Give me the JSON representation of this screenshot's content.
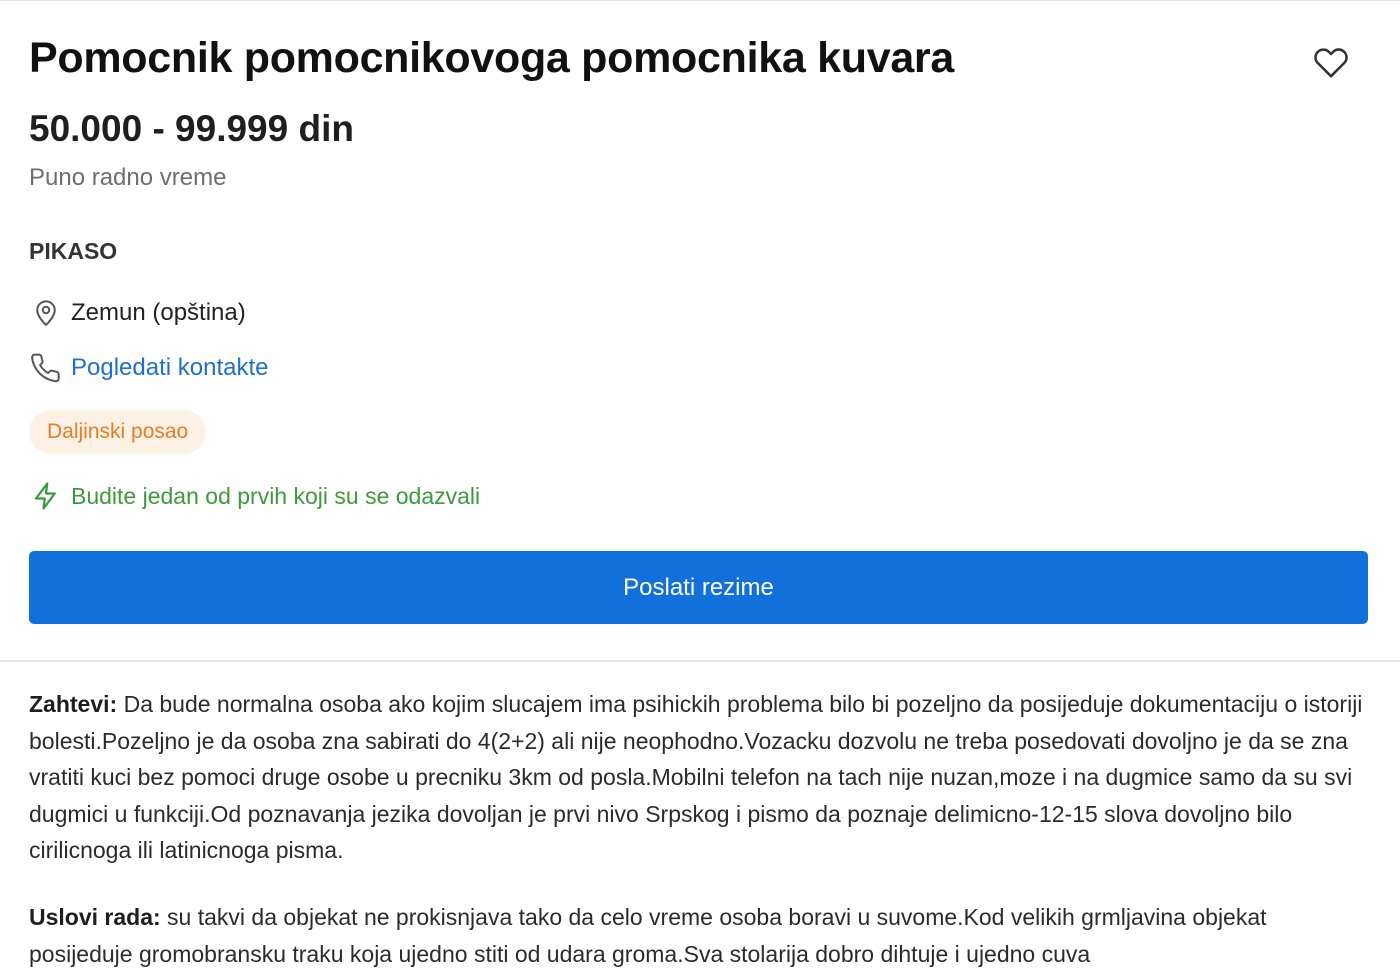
{
  "job": {
    "title": "Pomocnik pomocnikovoga pomocnika kuvara",
    "salary": "50.000 - 99.999 din",
    "work_type": "Puno radno vreme",
    "company": "PIKASO",
    "location": "Zemun (opština)",
    "contact_link": "Pogledati kontakte",
    "badge": "Daljinski posao",
    "early_applicant": "Budite jedan od prvih koji su se odazvali",
    "apply_button": "Poslati rezime"
  },
  "description": {
    "requirements_label": "Zahtevi:",
    "requirements_text": " Da bude normalna osoba ako kojim slucajem ima psihickih problema bilo bi pozeljno da posijeduje dokumentaciju o istoriji bolesti.Pozeljno je da osoba zna sabirati do 4(2+2) ali nije neophodno.Vozacku dozvolu ne treba posedovati dovoljno je da se zna vratiti kuci bez pomoci druge osobe u precniku 3km od posla.Mobilni telefon na tach nije nuzan,moze i na dugmice samo da su svi dugmici u funkciji.Od poznavanja jezika dovoljan je prvi nivo Srpskog i pismo da poznaje delimicno-12-15 slova dovoljno bilo cirilicnoga ili latinicnoga pisma.",
    "conditions_label": "Uslovi rada:",
    "conditions_text": " su takvi da objekat ne prokisnjava tako da celo vreme osoba boravi u suvome.Kod velikih grmljavina objekat posijeduje gromobransku traku koja ujedno stiti od udara groma.Sva stolarija dobro dihtuje i ujedno cuva"
  },
  "icons": {
    "favorite": "heart-outline-icon",
    "location": "map-pin-icon",
    "contact": "phone-icon",
    "early": "lightning-bolt-icon"
  },
  "colors": {
    "primary": "#1170da",
    "link": "#1f6fd1",
    "badge_bg": "#fdf0e4",
    "badge_text": "#e77d22",
    "success": "#3e9a3a",
    "muted": "#6e6e6e"
  }
}
